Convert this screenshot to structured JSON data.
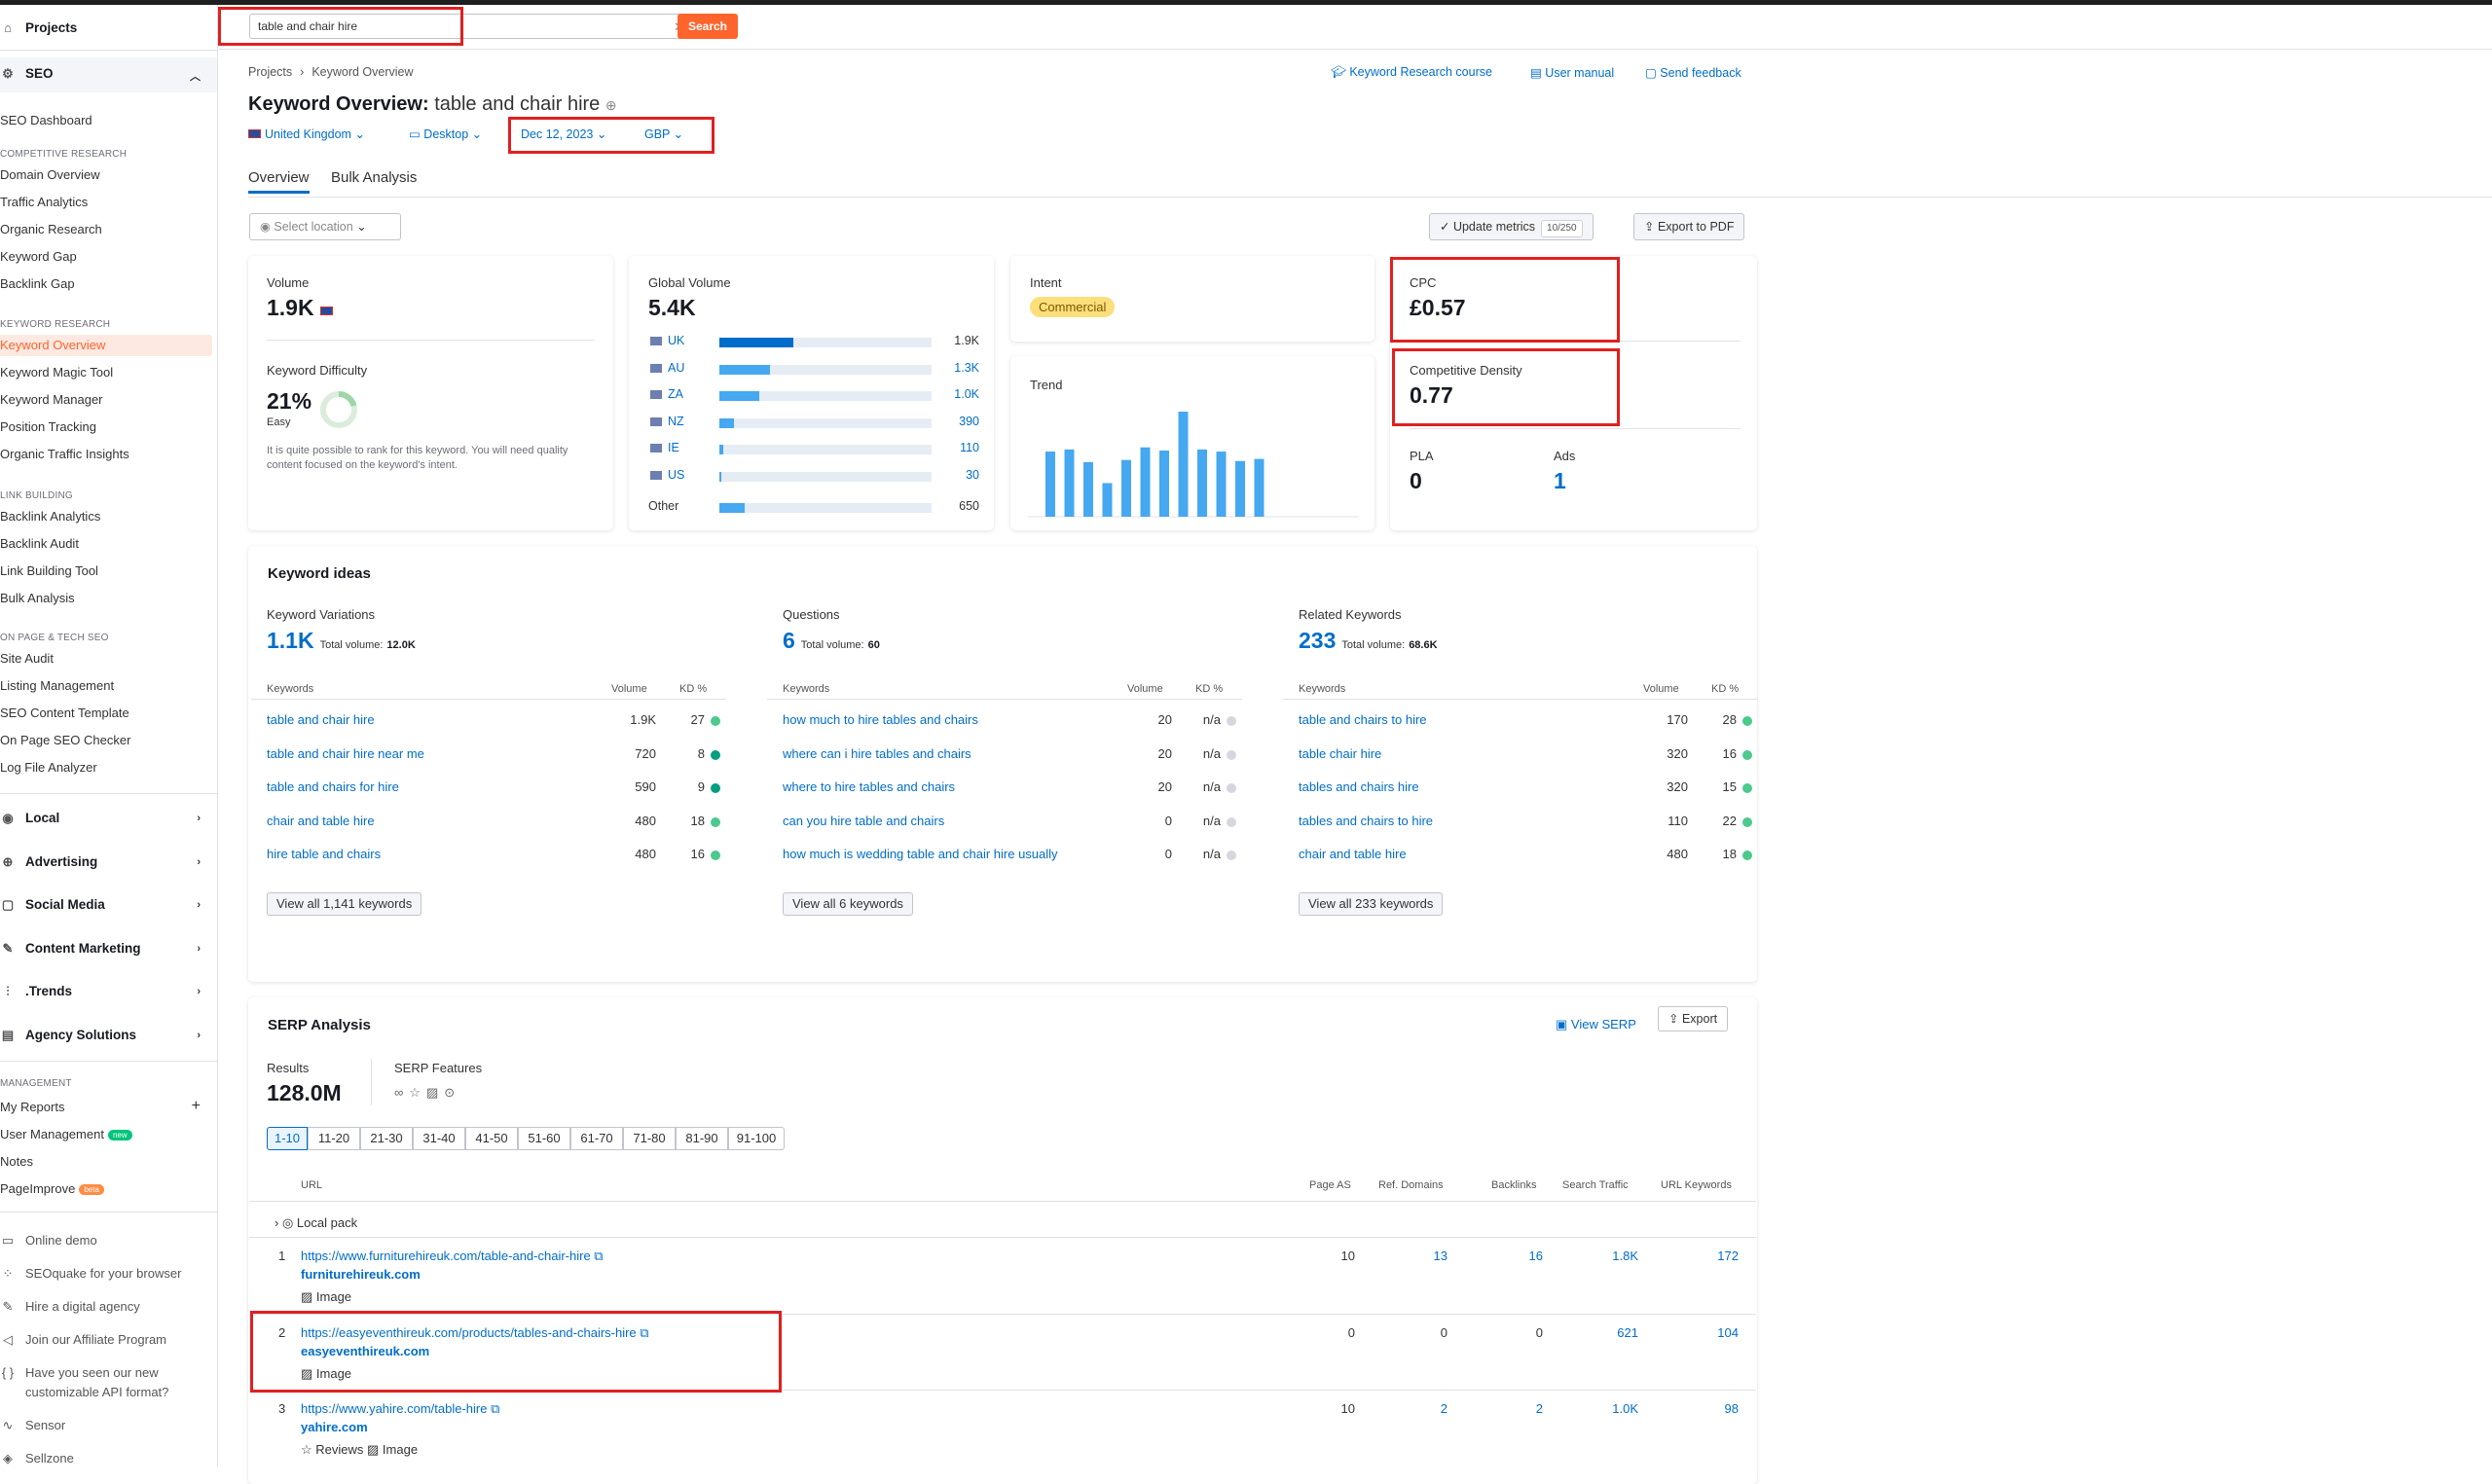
{
  "sidebar": {
    "projects": "Projects",
    "seo": "SEO",
    "seo_dashboard": "SEO Dashboard",
    "sections": {
      "competitive": "COMPETITIVE RESEARCH",
      "keyword": "KEYWORD RESEARCH",
      "link": "LINK BUILDING",
      "onpage": "ON PAGE & TECH SEO",
      "management": "MANAGEMENT"
    },
    "competitive_items": [
      "Domain Overview",
      "Traffic Analytics",
      "Organic Research",
      "Keyword Gap",
      "Backlink Gap"
    ],
    "keyword_items": [
      "Keyword Overview",
      "Keyword Magic Tool",
      "Keyword Manager",
      "Position Tracking",
      "Organic Traffic Insights"
    ],
    "link_items": [
      "Backlink Analytics",
      "Backlink Audit",
      "Link Building Tool",
      "Bulk Analysis"
    ],
    "onpage_items": [
      "Site Audit",
      "Listing Management",
      "SEO Content Template",
      "On Page SEO Checker",
      "Log File Analyzer"
    ],
    "groups": [
      "Local",
      "Advertising",
      "Social Media",
      "Content Marketing",
      ".Trends",
      "Agency Solutions"
    ],
    "management_items": [
      "My Reports",
      "User Management",
      "Notes",
      "PageImprove"
    ],
    "badge_new": "new",
    "badge_beta": "beta",
    "bottom_items": [
      "Online demo",
      "SEOquake for your browser",
      "Hire a digital agency",
      "Join our Affiliate Program",
      "Have you seen our new",
      "customizable API format?",
      "Sensor",
      "Sellzone"
    ]
  },
  "search": {
    "value": "table and chair hire",
    "button": "Search"
  },
  "breadcrumb": [
    "Projects",
    "Keyword Overview"
  ],
  "toplinks": {
    "course": "Keyword Research course",
    "manual": "User manual",
    "feedback": "Send feedback"
  },
  "title": {
    "prefix": "Keyword Overview:",
    "keyword": "table and chair hire"
  },
  "selectors": {
    "country": "United Kingdom",
    "device": "Desktop",
    "date": "Dec 12, 2023",
    "currency": "GBP"
  },
  "tabs": [
    "Overview",
    "Bulk Analysis"
  ],
  "location_placeholder": "Select location",
  "update_metrics": {
    "label": "Update metrics",
    "count": "10/250"
  },
  "export_pdf": "Export to PDF",
  "volume": {
    "label": "Volume",
    "value": "1.9K"
  },
  "kd": {
    "label": "Keyword Difficulty",
    "value": "21%",
    "level": "Easy",
    "percent": 21,
    "note": "It is quite possible to rank for this keyword. You will need quality content focused on the keyword's intent."
  },
  "global": {
    "label": "Global Volume",
    "value": "5.4K",
    "rows": [
      {
        "code": "UK",
        "value": "1.9K",
        "fill": 0.35,
        "color": "#006dca"
      },
      {
        "code": "AU",
        "value": "1.3K",
        "fill": 0.24,
        "color": "#45a8f1"
      },
      {
        "code": "ZA",
        "value": "1.0K",
        "fill": 0.19,
        "color": "#45a8f1"
      },
      {
        "code": "NZ",
        "value": "390",
        "fill": 0.07,
        "color": "#45a8f1"
      },
      {
        "code": "IE",
        "value": "110",
        "fill": 0.02,
        "color": "#45a8f1"
      },
      {
        "code": "US",
        "value": "30",
        "fill": 0.01,
        "color": "#45a8f1"
      },
      {
        "code": "Other",
        "value": "650",
        "fill": 0.12,
        "color": "#45a8f1"
      }
    ]
  },
  "intent": {
    "label": "Intent",
    "value": "Commercial"
  },
  "trend": {
    "label": "Trend",
    "values": [
      62,
      64,
      52,
      32,
      54,
      66,
      63,
      100,
      64,
      62,
      53,
      55
    ]
  },
  "cpc": {
    "label": "CPC",
    "value": "£0.57"
  },
  "density": {
    "label": "Competitive Density",
    "value": "0.77"
  },
  "pla": {
    "label": "PLA",
    "value": "0"
  },
  "ads": {
    "label": "Ads",
    "value": "1"
  },
  "ideas": {
    "title": "Keyword ideas",
    "total_label": "Total volume:",
    "col_keywords": "Keywords",
    "col_volume": "Volume",
    "col_kd": "KD %",
    "columns": [
      {
        "header": "Keyword Variations",
        "count": "1.1K",
        "total": "12.0K",
        "rows": [
          {
            "kw": "table and chair hire",
            "vol": "1.9K",
            "kd": "27",
            "color": "#4cc98c"
          },
          {
            "kw": "table and chair hire near me",
            "vol": "720",
            "kd": "8",
            "color": "#009f81"
          },
          {
            "kw": "table and chairs for hire",
            "vol": "590",
            "kd": "9",
            "color": "#009f81"
          },
          {
            "kw": "chair and table hire",
            "vol": "480",
            "kd": "18",
            "color": "#4cc98c"
          },
          {
            "kw": "hire table and chairs",
            "vol": "480",
            "kd": "16",
            "color": "#4cc98c"
          }
        ],
        "button": "View all 1,141 keywords"
      },
      {
        "header": "Questions",
        "count": "6",
        "total": "60",
        "rows": [
          {
            "kw": "how much to hire tables and chairs",
            "vol": "20",
            "kd": "n/a",
            "color": "#d5d7de"
          },
          {
            "kw": "where can i hire tables and chairs",
            "vol": "20",
            "kd": "n/a",
            "color": "#d5d7de"
          },
          {
            "kw": "where to hire tables and chairs",
            "vol": "20",
            "kd": "n/a",
            "color": "#d5d7de"
          },
          {
            "kw": "can you hire table and chairs",
            "vol": "0",
            "kd": "n/a",
            "color": "#d5d7de"
          },
          {
            "kw": "how much is wedding table and chair hire usually",
            "vol": "0",
            "kd": "n/a",
            "color": "#d5d7de"
          }
        ],
        "button": "View all 6 keywords"
      },
      {
        "header": "Related Keywords",
        "count": "233",
        "total": "68.6K",
        "rows": [
          {
            "kw": "table and chairs to hire",
            "vol": "170",
            "kd": "28",
            "color": "#4cc98c"
          },
          {
            "kw": "table chair hire",
            "vol": "320",
            "kd": "16",
            "color": "#4cc98c"
          },
          {
            "kw": "tables and chairs hire",
            "vol": "320",
            "kd": "15",
            "color": "#4cc98c"
          },
          {
            "kw": "tables and chairs to hire",
            "vol": "110",
            "kd": "22",
            "color": "#4cc98c"
          },
          {
            "kw": "chair and table hire",
            "vol": "480",
            "kd": "18",
            "color": "#4cc98c"
          }
        ],
        "button": "View all 233 keywords"
      }
    ]
  },
  "serp": {
    "title": "SERP Analysis",
    "view_serp": "View SERP",
    "export": "Export",
    "results_label": "Results",
    "results_value": "128.0M",
    "features_label": "SERP Features",
    "pages": [
      "1-10",
      "11-20",
      "21-30",
      "31-40",
      "41-50",
      "51-60",
      "61-70",
      "71-80",
      "81-90",
      "91-100"
    ],
    "cols": [
      "URL",
      "Page AS",
      "Ref. Domains",
      "Backlinks",
      "Search Traffic",
      "URL Keywords"
    ],
    "local_pack": "Local pack",
    "rows": [
      {
        "n": "1",
        "url": "https://www.furniturehireuk.com/table-and-chair-hire",
        "domain": "furniturehireuk.com",
        "features": "Image",
        "as": "10",
        "ref": "13",
        "bl": "16",
        "traffic": "1.8K",
        "kw": "172"
      },
      {
        "n": "2",
        "url": "https://easyeventhireuk.com/products/tables-and-chairs-hire",
        "domain": "easyeventhireuk.com",
        "features": "Image",
        "as": "0",
        "ref": "0",
        "bl": "0",
        "traffic": "621",
        "kw": "104"
      },
      {
        "n": "3",
        "url": "https://www.yahire.com/table-hire",
        "domain": "yahire.com",
        "features": "Reviews",
        "features2": "Image",
        "as": "10",
        "ref": "2",
        "bl": "2",
        "traffic": "1.0K",
        "kw": "98"
      }
    ]
  },
  "colors": {
    "accent": "#ff642d",
    "link": "#006dca",
    "highlight": "#e02020",
    "bar": "#45a8f1"
  }
}
